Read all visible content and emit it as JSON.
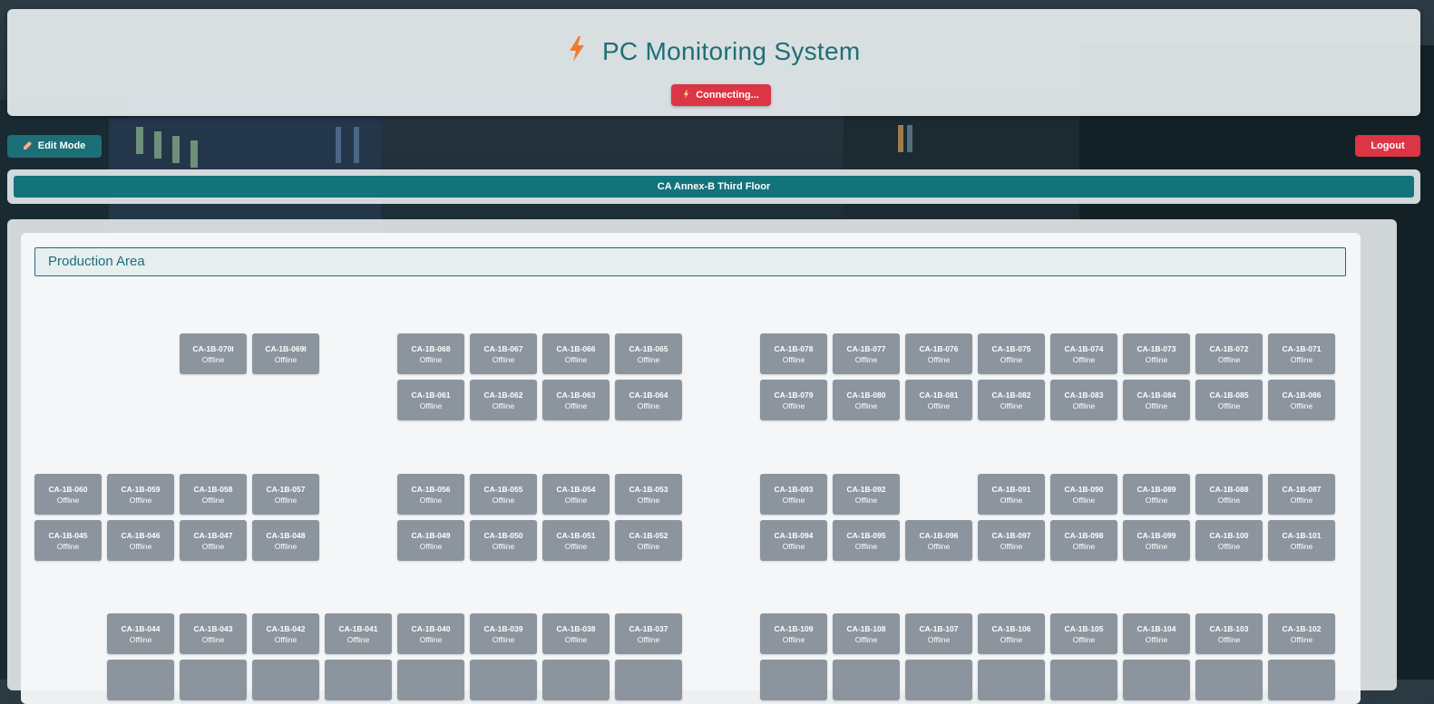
{
  "header": {
    "title": "PC Monitoring System",
    "status_label": "Connecting..."
  },
  "toolbar": {
    "edit_mode_label": "Edit Mode",
    "logout_label": "Logout"
  },
  "floor_tab": {
    "label": "CA Annex-B Third Floor"
  },
  "area": {
    "title": "Production Area"
  },
  "colors": {
    "accent": "#1d6f77",
    "danger": "#dc3545",
    "offline": "#8c959e"
  },
  "icons": {
    "title": "lightning-bolt-icon",
    "status": "lightning-bolt-icon",
    "edit": "pencil-icon"
  },
  "pcs": [
    {
      "name": "CA-1B-070I",
      "status": "Offline"
    },
    {
      "name": "CA-1B-069I",
      "status": "Offline"
    },
    {
      "name": "CA-1B-068",
      "status": "Offline"
    },
    {
      "name": "CA-1B-067",
      "status": "Offline"
    },
    {
      "name": "CA-1B-066",
      "status": "Offline"
    },
    {
      "name": "CA-1B-065",
      "status": "Offline"
    },
    {
      "name": "CA-1B-078",
      "status": "Offline"
    },
    {
      "name": "CA-1B-077",
      "status": "Offline"
    },
    {
      "name": "CA-1B-076",
      "status": "Offline"
    },
    {
      "name": "CA-1B-075",
      "status": "Offline"
    },
    {
      "name": "CA-1B-074",
      "status": "Offline"
    },
    {
      "name": "CA-1B-073",
      "status": "Offline"
    },
    {
      "name": "CA-1B-072",
      "status": "Offline"
    },
    {
      "name": "CA-1B-071",
      "status": "Offline"
    },
    {
      "name": "CA-1B-061",
      "status": "Offline"
    },
    {
      "name": "CA-1B-062",
      "status": "Offline"
    },
    {
      "name": "CA-1B-063",
      "status": "Offline"
    },
    {
      "name": "CA-1B-064",
      "status": "Offline"
    },
    {
      "name": "CA-1B-079",
      "status": "Offline"
    },
    {
      "name": "CA-1B-080",
      "status": "Offline"
    },
    {
      "name": "CA-1B-081",
      "status": "Offline"
    },
    {
      "name": "CA-1B-082",
      "status": "Offline"
    },
    {
      "name": "CA-1B-083",
      "status": "Offline"
    },
    {
      "name": "CA-1B-084",
      "status": "Offline"
    },
    {
      "name": "CA-1B-085",
      "status": "Offline"
    },
    {
      "name": "CA-1B-086",
      "status": "Offline"
    },
    {
      "name": "CA-1B-060",
      "status": "Offline"
    },
    {
      "name": "CA-1B-059",
      "status": "Offline"
    },
    {
      "name": "CA-1B-058",
      "status": "Offline"
    },
    {
      "name": "CA-1B-057",
      "status": "Offline"
    },
    {
      "name": "CA-1B-056",
      "status": "Offline"
    },
    {
      "name": "CA-1B-055",
      "status": "Offline"
    },
    {
      "name": "CA-1B-054",
      "status": "Offline"
    },
    {
      "name": "CA-1B-053",
      "status": "Offline"
    },
    {
      "name": "CA-1B-093",
      "status": "Offline"
    },
    {
      "name": "CA-1B-092",
      "status": "Offline"
    },
    {
      "name": "CA-1B-091",
      "status": "Offline"
    },
    {
      "name": "CA-1B-090",
      "status": "Offline"
    },
    {
      "name": "CA-1B-089",
      "status": "Offline"
    },
    {
      "name": "CA-1B-088",
      "status": "Offline"
    },
    {
      "name": "CA-1B-087",
      "status": "Offline"
    },
    {
      "name": "CA-1B-045",
      "status": "Offline"
    },
    {
      "name": "CA-1B-046",
      "status": "Offline"
    },
    {
      "name": "CA-1B-047",
      "status": "Offline"
    },
    {
      "name": "CA-1B-048",
      "status": "Offline"
    },
    {
      "name": "CA-1B-049",
      "status": "Offline"
    },
    {
      "name": "CA-1B-050",
      "status": "Offline"
    },
    {
      "name": "CA-1B-051",
      "status": "Offline"
    },
    {
      "name": "CA-1B-052",
      "status": "Offline"
    },
    {
      "name": "CA-1B-094",
      "status": "Offline"
    },
    {
      "name": "CA-1B-095",
      "status": "Offline"
    },
    {
      "name": "CA-1B-096",
      "status": "Offline"
    },
    {
      "name": "CA-1B-097",
      "status": "Offline"
    },
    {
      "name": "CA-1B-098",
      "status": "Offline"
    },
    {
      "name": "CA-1B-099",
      "status": "Offline"
    },
    {
      "name": "CA-1B-100",
      "status": "Offline"
    },
    {
      "name": "CA-1B-101",
      "status": "Offline"
    },
    {
      "name": "CA-1B-044",
      "status": "Offline"
    },
    {
      "name": "CA-1B-043",
      "status": "Offline"
    },
    {
      "name": "CA-1B-042",
      "status": "Offline"
    },
    {
      "name": "CA-1B-041",
      "status": "Offline"
    },
    {
      "name": "CA-1B-040",
      "status": "Offline"
    },
    {
      "name": "CA-1B-039",
      "status": "Offline"
    },
    {
      "name": "CA-1B-038",
      "status": "Offline"
    },
    {
      "name": "CA-1B-037",
      "status": "Offline"
    },
    {
      "name": "CA-1B-109",
      "status": "Offline"
    },
    {
      "name": "CA-1B-108",
      "status": "Offline"
    },
    {
      "name": "CA-1B-107",
      "status": "Offline"
    },
    {
      "name": "CA-1B-106",
      "status": "Offline"
    },
    {
      "name": "CA-1B-105",
      "status": "Offline"
    },
    {
      "name": "CA-1B-104",
      "status": "Offline"
    },
    {
      "name": "CA-1B-103",
      "status": "Offline"
    },
    {
      "name": "CA-1B-102",
      "status": "Offline"
    }
  ]
}
